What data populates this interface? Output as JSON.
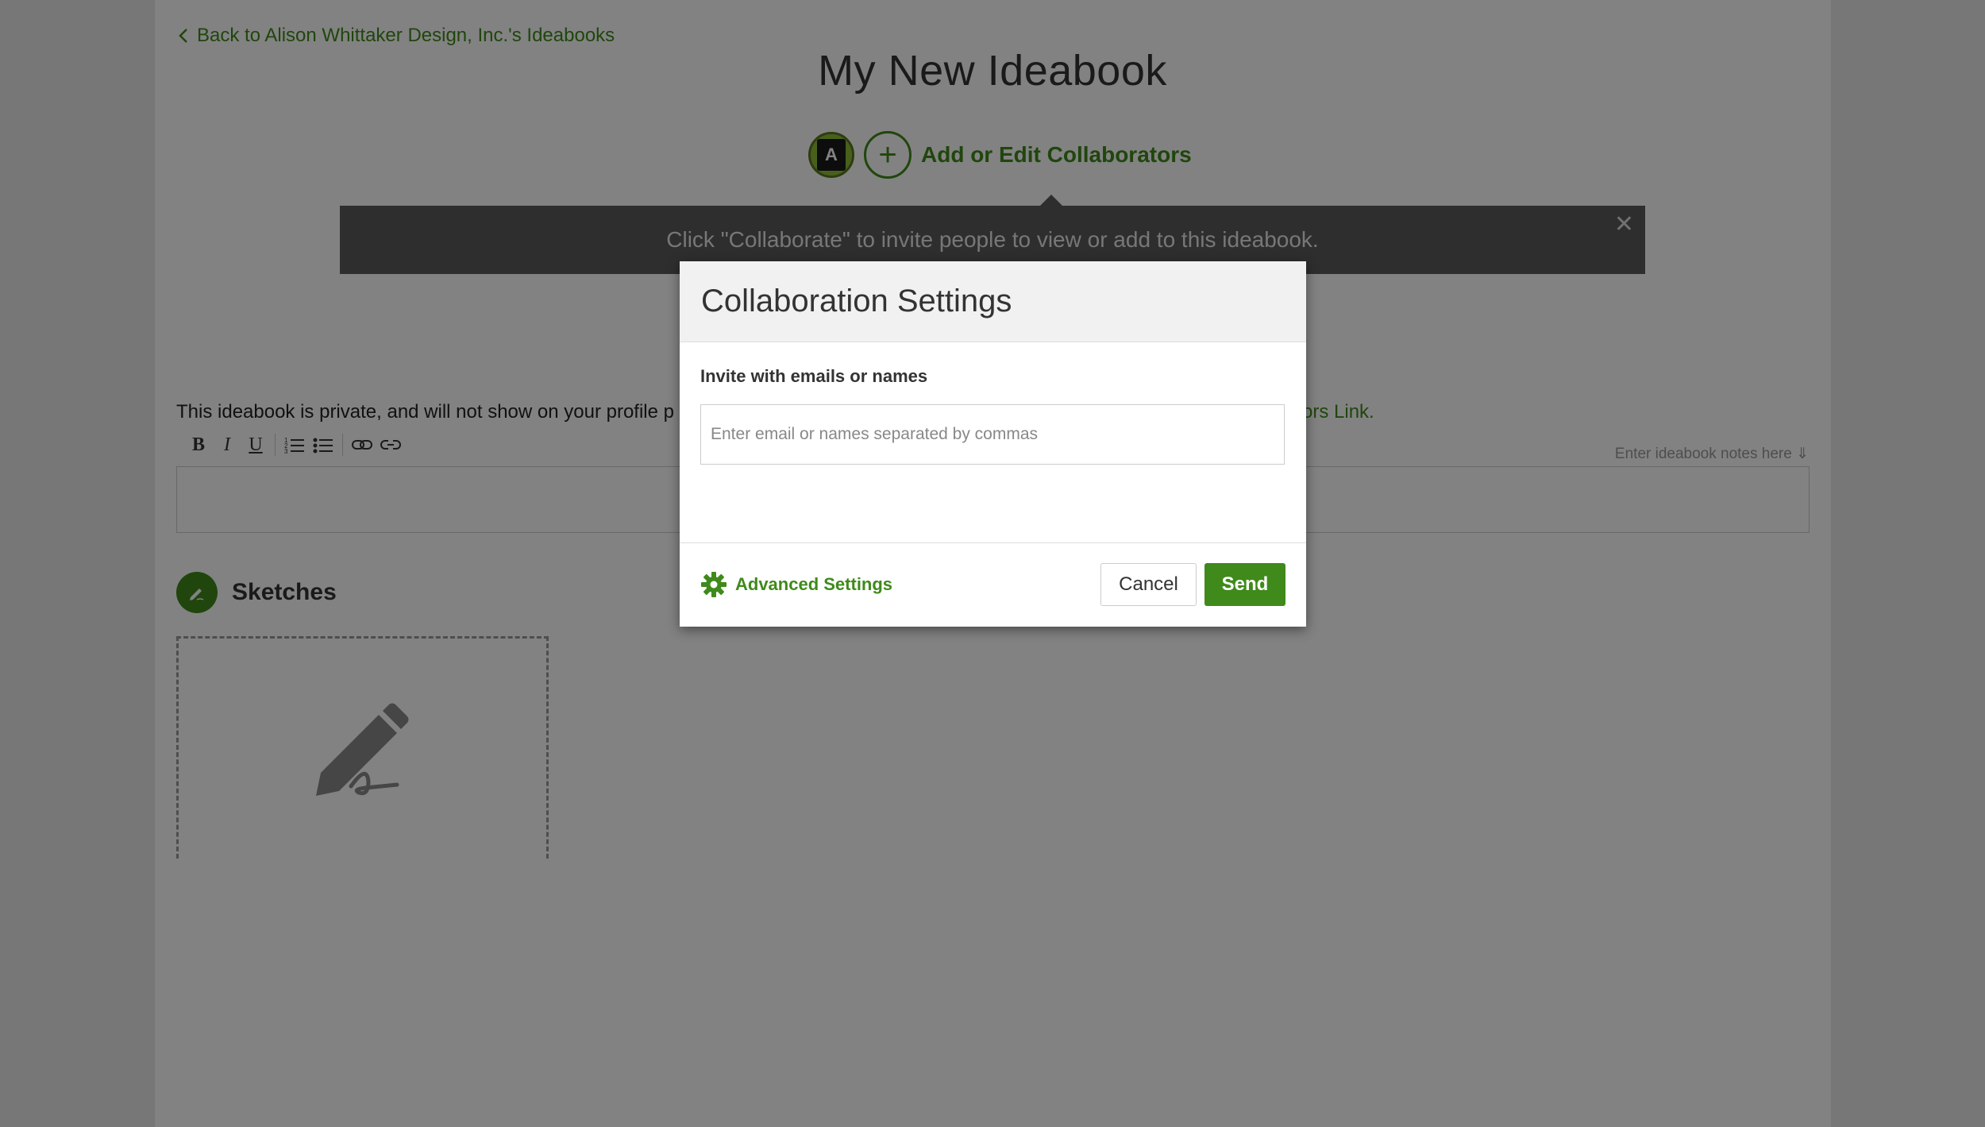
{
  "page": {
    "back_link": "Back to Alison Whittaker Design, Inc.'s Ideabooks",
    "title": "My New Ideabook",
    "avatar_letter": "A",
    "add_collaborators": "Add or Edit Collaborators",
    "tip_banner": "Click \"Collaborate\" to invite people to view or add to this ideabook.",
    "tip_close": "✕",
    "privacy_text": "This ideabook is private, and will not show on your profile p",
    "privacy_link_tail": "ators Link.",
    "notes_hint": "Enter ideabook notes here ⇓",
    "sketches_title": "Sketches",
    "toolbar": {
      "bold": "B",
      "italic": "I",
      "underline": "U"
    }
  },
  "modal": {
    "title": "Collaboration Settings",
    "invite_label": "Invite with emails or names",
    "invite_placeholder": "Enter email or names separated by commas",
    "invite_value": "",
    "advanced_settings": "Advanced Settings",
    "cancel": "Cancel",
    "send": "Send"
  },
  "colors": {
    "accent": "#3f8a1a",
    "overlay": "#000000",
    "banner": "#5a5a5a"
  },
  "icons": {
    "back": "chevron-left-icon",
    "add": "plus-icon",
    "close": "close-icon",
    "gear": "gear-icon",
    "sketch": "pencil-icon"
  }
}
